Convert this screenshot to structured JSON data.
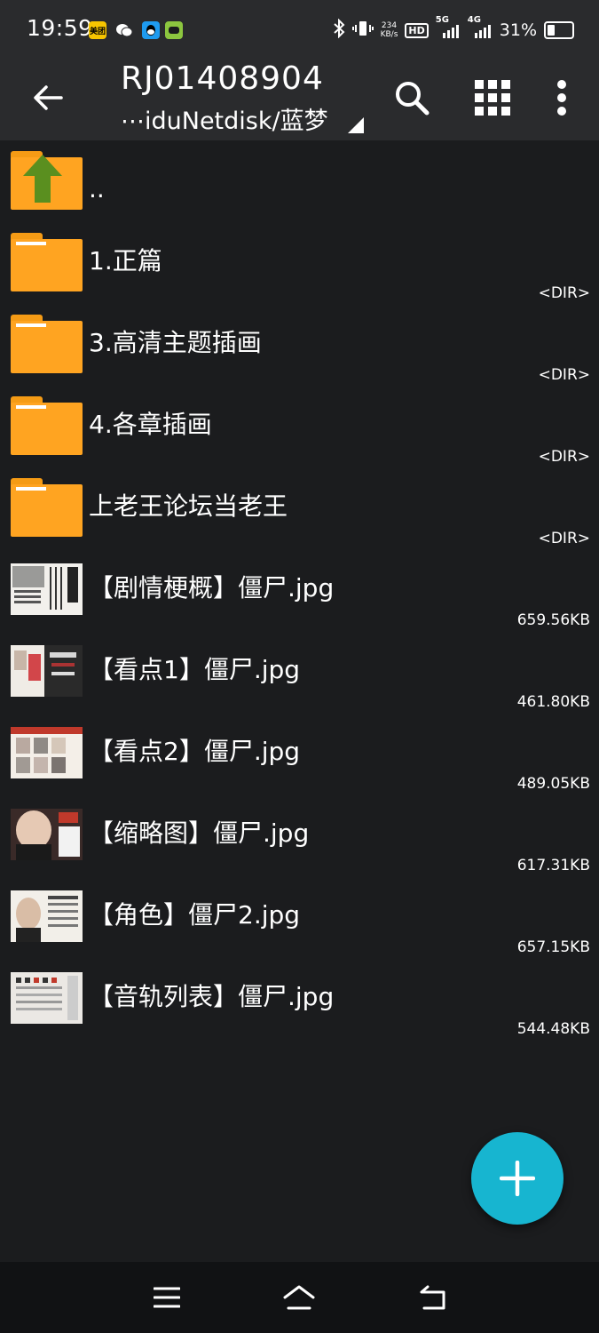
{
  "status_bar": {
    "time": "19:59",
    "app_icons": [
      "meituan-icon",
      "wechat-icon",
      "qq-icon",
      "game-icon"
    ],
    "app_icon_text": "美团",
    "net_speed_value": "234",
    "net_speed_unit": "KB/s",
    "hd_label": "HD",
    "signal_1_label": "5G",
    "signal_2_label": "4G",
    "battery_percent_text": "31%",
    "battery_level": 0.31
  },
  "app_bar": {
    "title": "RJ01408904",
    "subtitle": "⋯iduNetdisk/蓝梦",
    "icons": [
      "back-arrow-icon",
      "search-icon",
      "grid-view-icon",
      "more-vert-icon"
    ]
  },
  "files": [
    {
      "name": "..",
      "meta": "",
      "kind": "parent"
    },
    {
      "name": "1.正篇",
      "meta": "<DIR>",
      "kind": "folder"
    },
    {
      "name": "3.高清主题插画",
      "meta": "<DIR>",
      "kind": "folder"
    },
    {
      "name": "4.各章插画",
      "meta": "<DIR>",
      "kind": "folder"
    },
    {
      "name": "上老王论坛当老王",
      "meta": "<DIR>",
      "kind": "folder"
    },
    {
      "name": "【剧情梗概】僵尸.jpg",
      "meta": "659.56KB",
      "kind": "image"
    },
    {
      "name": "【看点1】僵尸.jpg",
      "meta": "461.80KB",
      "kind": "image"
    },
    {
      "name": "【看点2】僵尸.jpg",
      "meta": "489.05KB",
      "kind": "image"
    },
    {
      "name": "【缩略图】僵尸.jpg",
      "meta": "617.31KB",
      "kind": "image"
    },
    {
      "name": "【角色】僵尸2.jpg",
      "meta": "657.15KB",
      "kind": "image"
    },
    {
      "name": "【音轨列表】僵尸.jpg",
      "meta": "544.48KB",
      "kind": "image"
    }
  ],
  "fab": {
    "icon": "plus-icon"
  },
  "nav_bar": {
    "icons": [
      "menu-icon",
      "home-icon",
      "back-icon"
    ]
  },
  "colors": {
    "background": "#1b1c1e",
    "bar": "#2a2b2d",
    "folder": "#ffa421",
    "up_arrow": "#5a8f1f",
    "fab": "#17b5d0"
  }
}
